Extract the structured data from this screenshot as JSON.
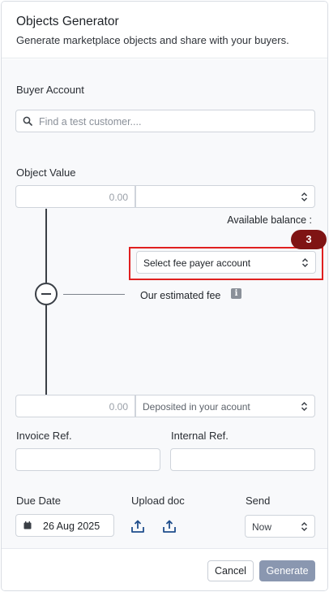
{
  "header": {
    "title": "Objects Generator",
    "subtitle": "Generate marketplace objects and share with your buyers."
  },
  "buyer": {
    "label": "Buyer Account",
    "placeholder": "Find a test customer...."
  },
  "object_value": {
    "label": "Object Value",
    "amount": "0.00",
    "currency_value": "",
    "available_balance_label": "Available balance :"
  },
  "fee": {
    "payer_select": "Select fee payer account",
    "estimated_label": "Our estimated fee",
    "step_badge": "3"
  },
  "deposit": {
    "amount": "0.00",
    "select": "Deposited in your acount"
  },
  "refs": {
    "invoice_label": "Invoice Ref.",
    "internal_label": "Internal Ref.",
    "invoice_value": "",
    "internal_value": ""
  },
  "due": {
    "label": "Due Date",
    "value": "26 Aug 2025"
  },
  "upload": {
    "label": "Upload doc"
  },
  "send": {
    "label": "Send",
    "value": "Now"
  },
  "footer": {
    "cancel": "Cancel",
    "generate": "Generate"
  },
  "colors": {
    "highlight": "#e02020",
    "badge": "#7f1414",
    "generate_button": "#8a97b0",
    "icon_blue": "#1f4e8c"
  }
}
